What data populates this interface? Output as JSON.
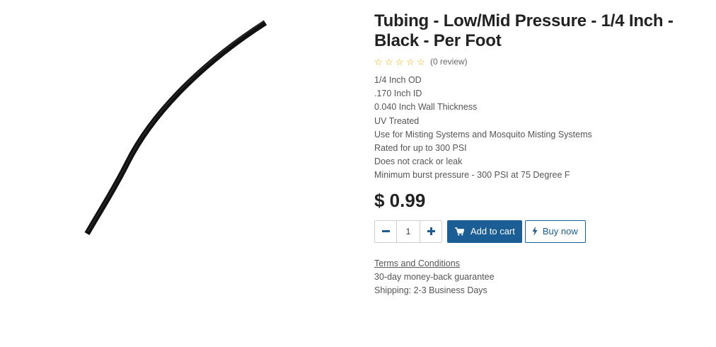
{
  "product": {
    "title": "Tubing - Low/Mid Pressure - 1/4 Inch - Black - Per Foot",
    "image_alt": "Black tubing",
    "rating": {
      "stars": 0,
      "max": 5,
      "review_label": "(0 review)",
      "star_color": "#f0ad00"
    },
    "features": [
      "1/4 Inch OD",
      ".170 Inch ID",
      "0.040 Inch Wall Thickness",
      "UV Treated",
      "Use for Misting Systems and Mosquito Misting Systems",
      "Rated for up to 300 PSI",
      "Does not crack or leak",
      "Minimum burst pressure - 300 PSI at 75 Degree F"
    ],
    "price": "$ 0.99"
  },
  "cart": {
    "quantity": "1",
    "minus_icon": "minus-icon",
    "plus_icon": "plus-icon",
    "add_to_cart_label": "Add to cart",
    "add_to_cart_icon": "cart-icon",
    "buy_now_label": "Buy now",
    "buy_now_icon": "lightning-icon",
    "accent_color": "#1a5e95"
  },
  "extras": {
    "terms_label": "Terms and Conditions",
    "guarantee": "30-day money-back guarantee",
    "shipping": "Shipping: 2-3 Business Days"
  }
}
